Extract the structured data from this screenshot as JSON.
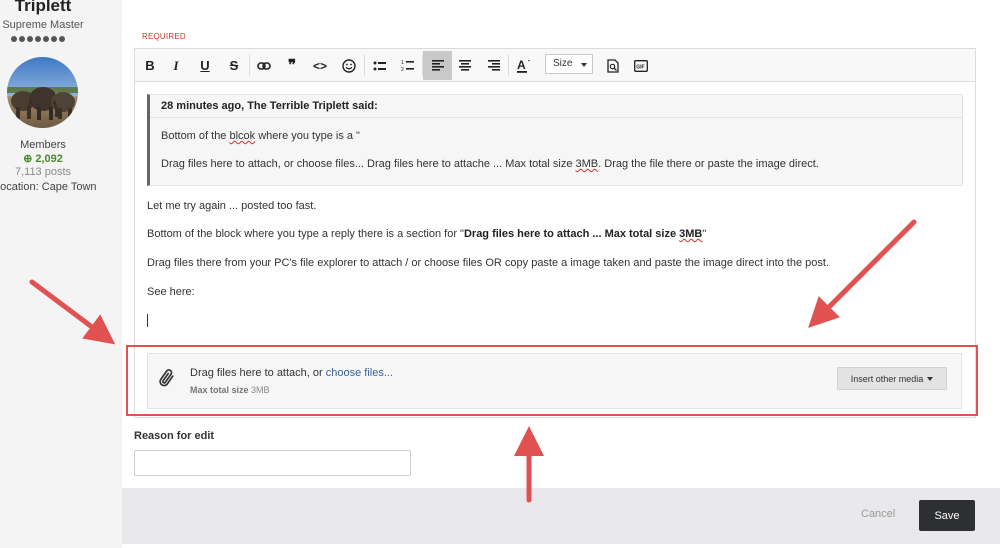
{
  "author": {
    "name": "Triplett",
    "rank": "Supreme Master",
    "group": "Members",
    "reputation": "2,092",
    "posts": "7,113 posts",
    "location": "Location: Cape Town"
  },
  "form": {
    "required_label": "REQUIRED"
  },
  "toolbar": {
    "bold": "B",
    "italic": "I",
    "underline": "U",
    "strike": "S",
    "size_label": "Size"
  },
  "quote": {
    "header": "28 minutes ago, The Terrible Triplett said:",
    "line1_before": "Bottom of the ",
    "line1_misspelled": "blcok",
    "line1_after": " where you type is a \"",
    "line2_before": "Drag files here to attach, or choose files... Drag files here to attache ... Max total size ",
    "line2_mid": "3MB",
    "line2_after": ". Drag the file there or paste the image direct."
  },
  "body": {
    "line1": "Let me try again ... posted too fast.",
    "line2_before": "Bottom of the block where you type a reply there is a section for \"",
    "line2_bold_a": "Drag files here to attach ... Max total size ",
    "line2_bold_b": "3MB",
    "line2_after": "\"",
    "line3": "Drag files there from your PC's file explorer to attach / or choose files OR copy paste a image taken and paste the image direct into the post.",
    "line4": "See here:"
  },
  "dropzone": {
    "text": "Drag files here to attach, or ",
    "link": "choose files...",
    "max_label": "Max total size",
    "max_value": " 3MB",
    "insert_media": "Insert other media"
  },
  "reason": {
    "label": "Reason for edit",
    "value": "",
    "placeholder": ""
  },
  "footer": {
    "cancel": "Cancel",
    "save": "Save"
  },
  "colors": {
    "annotation_red": "#e15151",
    "link": "#3d6594",
    "reputation_green": "#4a8a2a",
    "save_button": "#2d2f31"
  },
  "icons": [
    "bold-icon",
    "italic-icon",
    "underline-icon",
    "strikethrough-icon",
    "link-icon",
    "quote-icon",
    "code-icon",
    "emoji-icon",
    "bullet-list-icon",
    "numbered-list-icon",
    "align-left-icon",
    "align-center-icon",
    "align-right-icon",
    "text-color-icon",
    "preview-icon",
    "gif-icon",
    "paperclip-icon"
  ]
}
